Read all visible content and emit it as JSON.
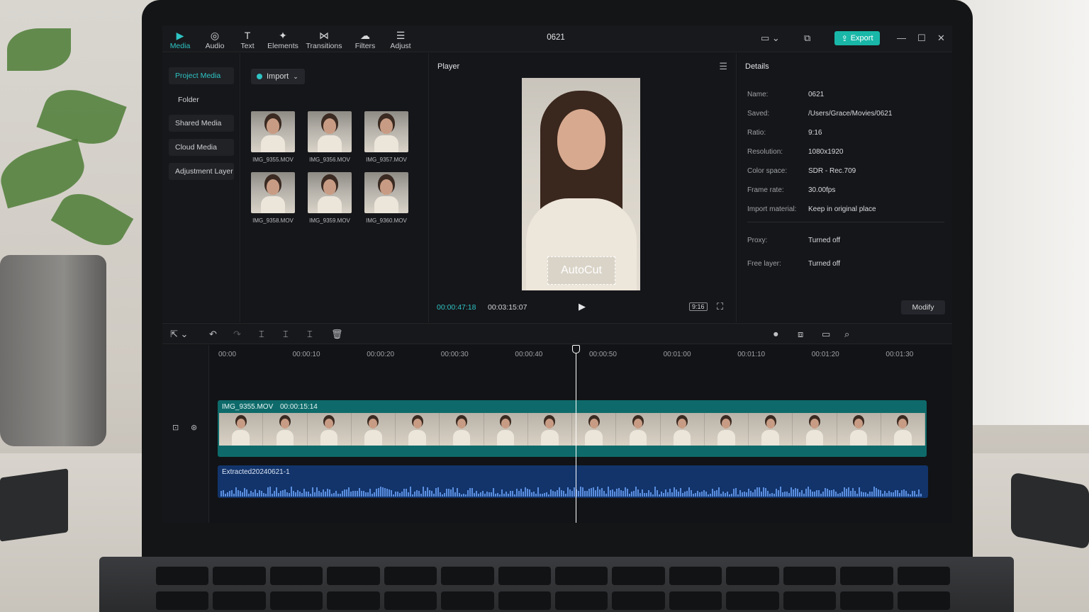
{
  "toolbar": {
    "tools": [
      {
        "label": "Media",
        "icon": "media-icon",
        "glyph": "▶",
        "active": true
      },
      {
        "label": "Audio",
        "icon": "audio-icon",
        "glyph": "◎",
        "active": false
      },
      {
        "label": "Text",
        "icon": "text-icon",
        "glyph": "T",
        "active": false
      },
      {
        "label": "Elements",
        "icon": "elements-icon",
        "glyph": "✦",
        "active": false
      },
      {
        "label": "Transitions",
        "icon": "transitions-icon",
        "glyph": "⋈",
        "active": false
      },
      {
        "label": "Filters",
        "icon": "filters-icon",
        "glyph": "☁",
        "active": false
      },
      {
        "label": "Adjust",
        "icon": "adjust-icon",
        "glyph": "☰",
        "active": false
      }
    ],
    "title": "0621",
    "export_label": "Export",
    "accent_color": "#19b7a8"
  },
  "media_sidebar": {
    "items": [
      "Project Media",
      "Folder",
      "Shared Media",
      "Cloud Media",
      "Adjustment Layer"
    ]
  },
  "media_panel": {
    "import_label": "Import",
    "clips": [
      "IMG_9355.MOV",
      "IMG_9356.MOV",
      "IMG_9357.MOV",
      "IMG_9358.MOV",
      "IMG_9359.MOV",
      "IMG_9360.MOV"
    ]
  },
  "player": {
    "title": "Player",
    "overlay_text": "AutoCut",
    "current_time": "00:00:47:18",
    "total_time": "00:03:15:07",
    "ratio": "9:16"
  },
  "details": {
    "title": "Details",
    "rows": [
      {
        "key": "Name:",
        "value": "0621"
      },
      {
        "key": "Saved:",
        "value": "/Users/Grace/Movies/0621"
      },
      {
        "key": "Ratio:",
        "value": "9:16"
      },
      {
        "key": "Resolution:",
        "value": "1080x1920"
      },
      {
        "key": "Color space:",
        "value": "SDR - Rec.709"
      },
      {
        "key": "Frame rate:",
        "value": "30.00fps"
      },
      {
        "key": "Import material:",
        "value": "Keep in original place"
      }
    ],
    "rows2": [
      {
        "key": "Proxy:",
        "value": "Turned off"
      },
      {
        "key": "Free layer:",
        "value": "Turned off"
      }
    ],
    "modify_label": "Modify"
  },
  "timeline": {
    "ruler": [
      "00:00",
      "00:00:10",
      "00:00:20",
      "00:00:30",
      "00:00:40",
      "00:00:50",
      "00:01:00",
      "00:01:10",
      "00:01:20",
      "00:01:30"
    ],
    "video_clip_name": "IMG_9355.MOV",
    "video_clip_duration": "00:00:15:14",
    "audio_clip_name": "Extracted20240621-1",
    "video_color": "#0e6a6a",
    "audio_color": "#12346b"
  }
}
